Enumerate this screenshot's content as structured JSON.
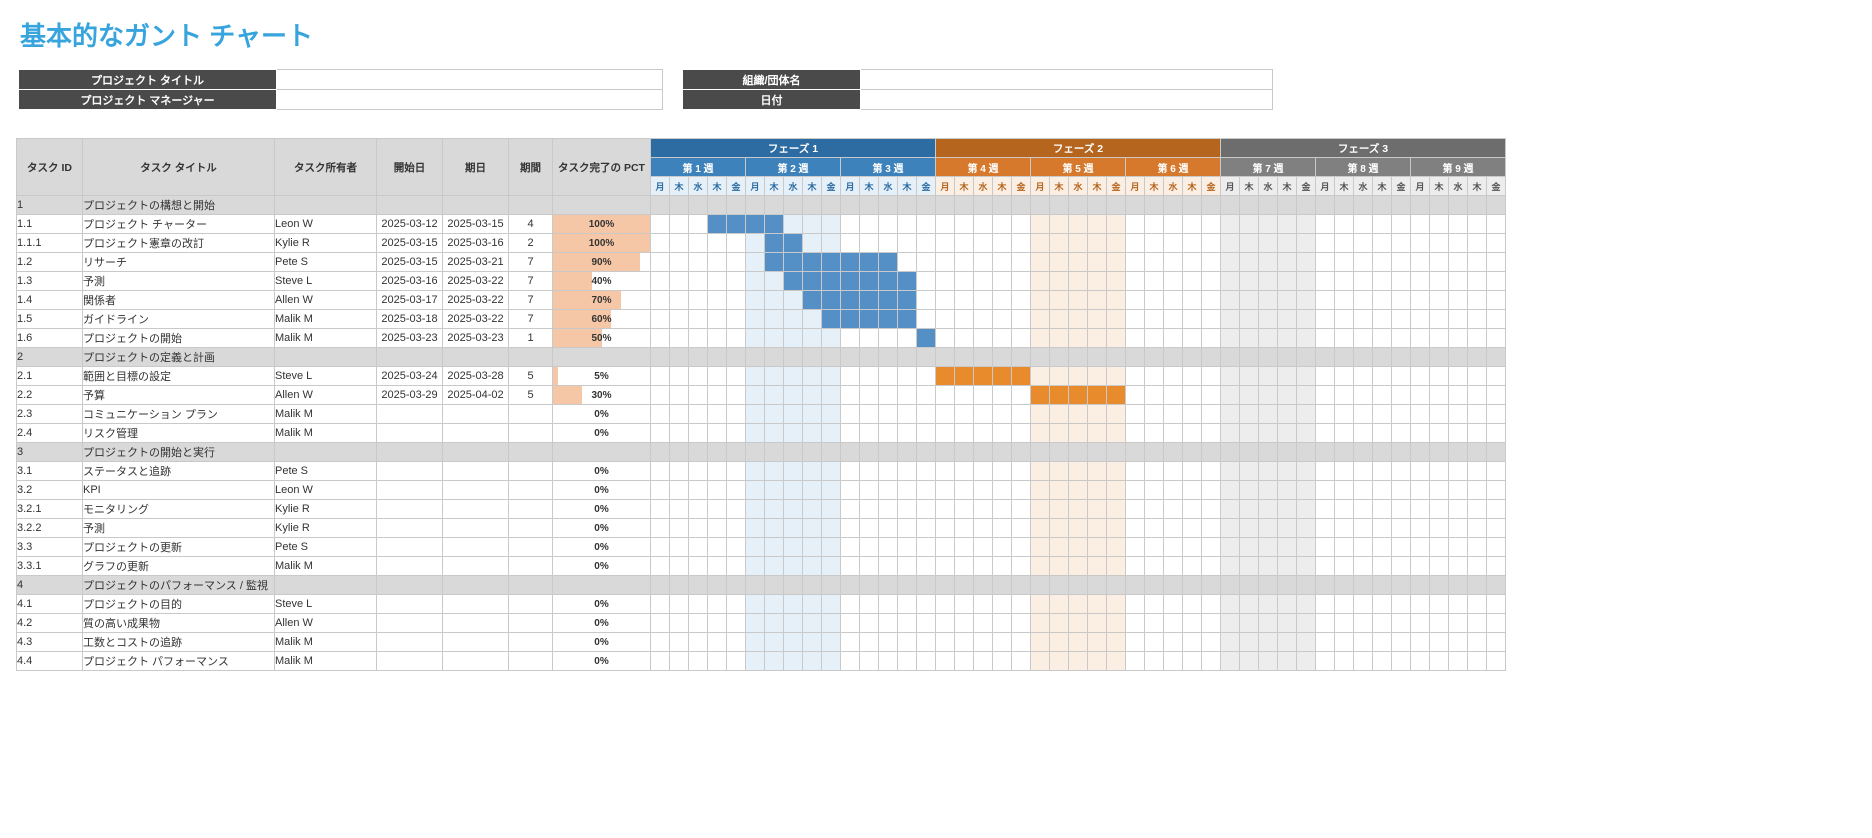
{
  "title": "基本的なガント チャート",
  "meta": {
    "project_title_label": "プロジェクト タイトル",
    "project_title_value": "",
    "org_label": "組織/団体名",
    "org_value": "",
    "pm_label": "プロジェクト マネージャー",
    "pm_value": "",
    "date_label": "日付",
    "date_value": ""
  },
  "columns": {
    "id": "タスク ID",
    "title": "タスク タイトル",
    "owner": "タスク所有者",
    "start": "開始日",
    "end": "期日",
    "duration": "期間",
    "pct": "タスク完了の PCT"
  },
  "phases": [
    {
      "label": "フェーズ 1",
      "weeks": [
        "第 1 週",
        "第 2 週",
        "第 3 週"
      ],
      "tone": 1
    },
    {
      "label": "フェーズ 2",
      "weeks": [
        "第 4 週",
        "第 5 週",
        "第 6 週"
      ],
      "tone": 2
    },
    {
      "label": "フェーズ 3",
      "weeks": [
        "第 7 週",
        "第 8 週",
        "第 9 週"
      ],
      "tone": 3
    }
  ],
  "day_labels": [
    "月",
    "木",
    "水",
    "木",
    "金"
  ],
  "shaded_cols": {
    "blue": [
      5,
      6,
      7,
      8,
      9
    ],
    "orange": [
      20,
      21,
      22,
      23,
      24
    ],
    "grey": [
      30,
      31,
      32,
      33,
      34
    ]
  },
  "rows": [
    {
      "id": "1",
      "title": "プロジェクトの構想と開始",
      "section": true
    },
    {
      "id": "1.1",
      "title": "プロジェクト チャーター",
      "owner": "Leon W",
      "start": "2025-03-12",
      "end": "2025-03-15",
      "dur": "4",
      "pct": 100,
      "indent": 1,
      "bar": {
        "color": "b",
        "from": 3,
        "to": 6
      }
    },
    {
      "id": "1.1.1",
      "title": "プロジェクト憲章の改訂",
      "owner": "Kylie R",
      "start": "2025-03-15",
      "end": "2025-03-16",
      "dur": "2",
      "pct": 100,
      "indent": 2,
      "bar": {
        "color": "b",
        "from": 6,
        "to": 7
      }
    },
    {
      "id": "1.2",
      "title": "リサーチ",
      "owner": "Pete S",
      "start": "2025-03-15",
      "end": "2025-03-21",
      "dur": "7",
      "pct": 90,
      "indent": 1,
      "bar": {
        "color": "b",
        "from": 6,
        "to": 12
      }
    },
    {
      "id": "1.3",
      "title": "予測",
      "owner": "Steve L",
      "start": "2025-03-16",
      "end": "2025-03-22",
      "dur": "7",
      "pct": 40,
      "indent": 1,
      "bar": {
        "color": "b",
        "from": 7,
        "to": 13
      }
    },
    {
      "id": "1.4",
      "title": "関係者",
      "owner": "Allen W",
      "start": "2025-03-17",
      "end": "2025-03-22",
      "dur": "7",
      "pct": 70,
      "indent": 1,
      "bar": {
        "color": "b",
        "from": 8,
        "to": 13
      }
    },
    {
      "id": "1.5",
      "title": "ガイドライン",
      "owner": "Malik M",
      "start": "2025-03-18",
      "end": "2025-03-22",
      "dur": "7",
      "pct": 60,
      "indent": 1,
      "bar": {
        "color": "b",
        "from": 9,
        "to": 13
      }
    },
    {
      "id": "1.6",
      "title": "プロジェクトの開始",
      "owner": "Malik M",
      "start": "2025-03-23",
      "end": "2025-03-23",
      "dur": "1",
      "pct": 50,
      "indent": 1,
      "bar": {
        "color": "b",
        "from": 14,
        "to": 14
      }
    },
    {
      "id": "2",
      "title": "プロジェクトの定義と計画",
      "section": true
    },
    {
      "id": "2.1",
      "title": "範囲と目標の設定",
      "owner": "Steve L",
      "start": "2025-03-24",
      "end": "2025-03-28",
      "dur": "5",
      "pct": 5,
      "indent": 1,
      "bar": {
        "color": "o",
        "from": 15,
        "to": 19
      }
    },
    {
      "id": "2.2",
      "title": "予算",
      "owner": "Allen W",
      "start": "2025-03-29",
      "end": "2025-04-02",
      "dur": "5",
      "pct": 30,
      "indent": 1,
      "bar": {
        "color": "o",
        "from": 20,
        "to": 24
      }
    },
    {
      "id": "2.3",
      "title": "コミュニケーション プラン",
      "owner": "Malik M",
      "pct": 0,
      "indent": 1
    },
    {
      "id": "2.4",
      "title": "リスク管理",
      "owner": "Malik M",
      "pct": 0,
      "indent": 1
    },
    {
      "id": "3",
      "title": "プロジェクトの開始と実行",
      "section": true
    },
    {
      "id": "3.1",
      "title": "ステータスと追跡",
      "owner": "Pete S",
      "pct": 0,
      "indent": 1
    },
    {
      "id": "3.2",
      "title": "KPI",
      "owner": "Leon W",
      "pct": 0,
      "indent": 1
    },
    {
      "id": "3.2.1",
      "title": "モニタリング",
      "owner": "Kylie R",
      "pct": 0,
      "indent": 2
    },
    {
      "id": "3.2.2",
      "title": "予測",
      "owner": "Kylie R",
      "pct": 0,
      "indent": 2
    },
    {
      "id": "3.3",
      "title": "プロジェクトの更新",
      "owner": "Pete S",
      "pct": 0,
      "indent": 1
    },
    {
      "id": "3.3.1",
      "title": "グラフの更新",
      "owner": "Malik M",
      "pct": 0,
      "indent": 2
    },
    {
      "id": "4",
      "title": "プロジェクトのパフォーマンス / 監視",
      "section": true
    },
    {
      "id": "4.1",
      "title": "プロジェクトの目的",
      "owner": "Steve L",
      "pct": 0,
      "indent": 1
    },
    {
      "id": "4.2",
      "title": "質の高い成果物",
      "owner": "Allen W",
      "pct": 0,
      "indent": 1
    },
    {
      "id": "4.3",
      "title": "工数とコストの追跡",
      "owner": "Malik M",
      "pct": 0,
      "indent": 1
    },
    {
      "id": "4.4",
      "title": "プロジェクト パフォーマンス",
      "owner": "Malik M",
      "pct": 0,
      "indent": 1
    }
  ]
}
